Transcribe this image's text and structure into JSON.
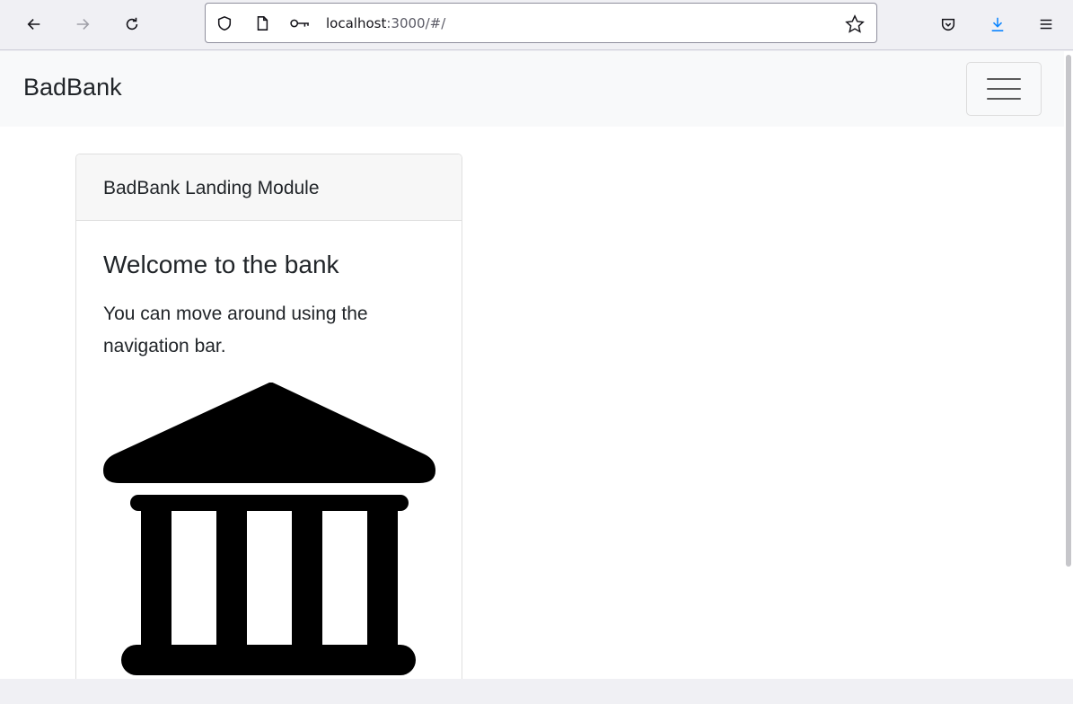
{
  "browser": {
    "url_host": "localhost",
    "url_path": ":3000/#/"
  },
  "navbar": {
    "brand": "BadBank"
  },
  "card": {
    "header": "BadBank Landing Module",
    "title": "Welcome to the bank",
    "text": "You can move around using the navigation bar.",
    "image_icon": "bank-icon"
  }
}
